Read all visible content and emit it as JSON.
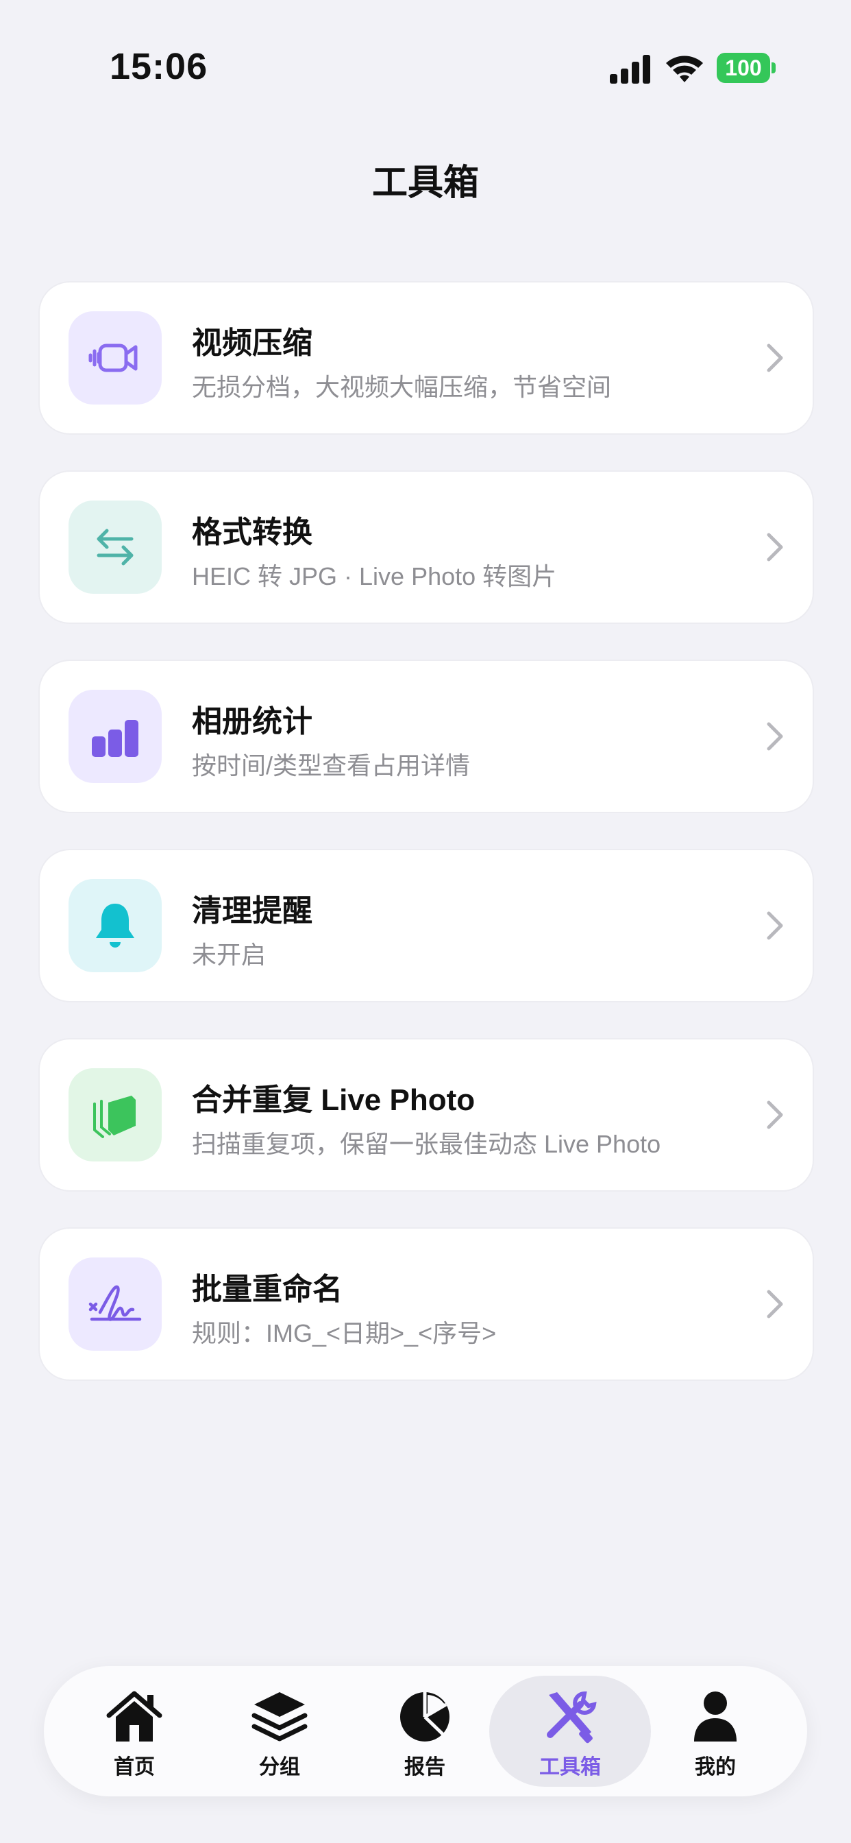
{
  "status_bar": {
    "time": "15:06",
    "battery": "100",
    "battery_color": "#34c759"
  },
  "header": {
    "title": "工具箱"
  },
  "tools": [
    {
      "title": "视频压缩",
      "subtitle": "无损分档，大视频大幅压缩，节省空间",
      "icon": "video-camera-icon",
      "icon_bg": "#ede9ff",
      "icon_color": "#8a6cf0"
    },
    {
      "title": "格式转换",
      "subtitle": "HEIC 转 JPG · Live Photo 转图片",
      "icon": "arrows-swap-icon",
      "icon_bg": "#e3f4f1",
      "icon_color": "#4fb3a8"
    },
    {
      "title": "相册统计",
      "subtitle": "按时间/类型查看占用详情",
      "icon": "bar-chart-icon",
      "icon_bg": "#ede9ff",
      "icon_color": "#7b5ce6"
    },
    {
      "title": "清理提醒",
      "subtitle": "未开启",
      "icon": "bell-icon",
      "icon_bg": "#dff5f8",
      "icon_color": "#13c1cf"
    },
    {
      "title": "合并重复 Live Photo",
      "subtitle": "扫描重复项，保留一张最佳动态 Live Photo",
      "icon": "stacked-cards-icon",
      "icon_bg": "#e2f6e6",
      "icon_color": "#3cc45c"
    },
    {
      "title": "批量重命名",
      "subtitle": "规则：IMG_<日期>_<序号>",
      "icon": "signature-icon",
      "icon_bg": "#ede9ff",
      "icon_color": "#7b5ce6"
    }
  ],
  "tab_bar": {
    "active_color": "#7b5ce6",
    "tabs": [
      {
        "label": "首页",
        "icon": "house-icon",
        "active": false
      },
      {
        "label": "分组",
        "icon": "layers-icon",
        "active": false
      },
      {
        "label": "报告",
        "icon": "pie-chart-icon",
        "active": false
      },
      {
        "label": "工具箱",
        "icon": "tools-icon",
        "active": true
      },
      {
        "label": "我的",
        "icon": "person-icon",
        "active": false
      }
    ]
  }
}
